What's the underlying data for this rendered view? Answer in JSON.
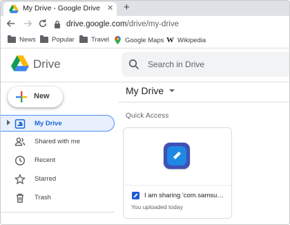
{
  "browser": {
    "tab": {
      "title": "My Drive - Google Drive",
      "favicon": "google-drive-icon",
      "close": "✕"
    },
    "new_tab": "+",
    "url": {
      "host": "drive.google.com",
      "path": "/drive/my-drive"
    },
    "bookmarks": [
      {
        "label": "News",
        "icon": "folder-icon"
      },
      {
        "label": "Popular",
        "icon": "folder-icon"
      },
      {
        "label": "Travel",
        "icon": "folder-icon"
      },
      {
        "label": "Google Maps",
        "icon": "google-maps-icon"
      },
      {
        "label": "Wikipedia",
        "icon": "wikipedia-icon"
      }
    ]
  },
  "drive": {
    "app_name": "Drive",
    "search_placeholder": "Search in Drive",
    "new_button": "New",
    "nav": [
      {
        "label": "My Drive",
        "icon": "my-drive-icon",
        "active": true
      },
      {
        "label": "Shared with me",
        "icon": "people-icon"
      },
      {
        "label": "Recent",
        "icon": "clock-icon"
      },
      {
        "label": "Starred",
        "icon": "star-icon"
      },
      {
        "label": "Trash",
        "icon": "trash-icon"
      }
    ],
    "main_title": "My Drive",
    "quick_access_label": "Quick Access",
    "file": {
      "name": "I am sharing 'com.samsung...",
      "subtitle": "You uploaded today",
      "icon": "samsung-notes-icon"
    }
  },
  "colors": {
    "accent_blue": "#1967d2",
    "active_bg": "#e8f0fe",
    "app_icon": "#3f51b5"
  }
}
